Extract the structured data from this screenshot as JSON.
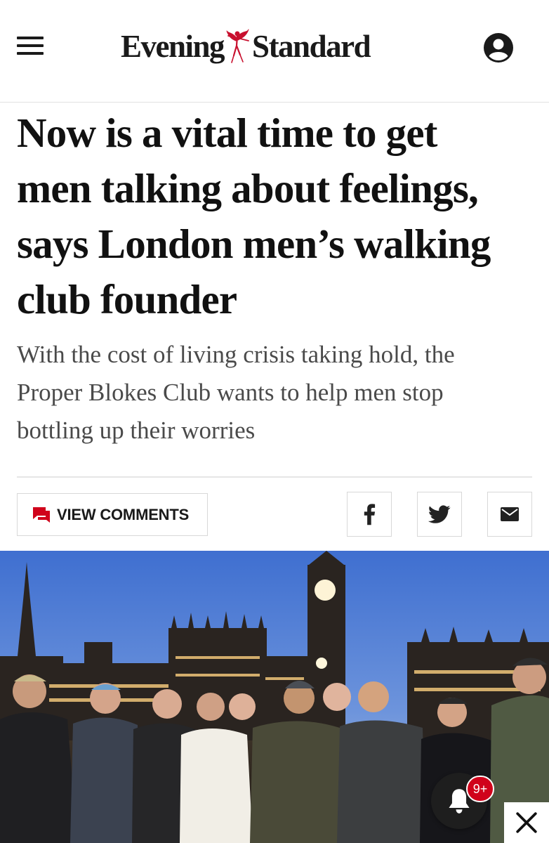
{
  "header": {
    "logo_left": "Evening",
    "logo_right": "Standard",
    "menu_icon": "hamburger-menu-icon",
    "account_icon": "user-account-icon"
  },
  "article": {
    "headline_lines": [
      "Now is a vital time to get",
      "men talking about feelings,",
      "says London men’s walking",
      "club founder"
    ],
    "standfirst_lines": [
      "With the cost of living crisis taking hold, the",
      "Proper Blokes Club wants to help men stop",
      "bottling up their worries"
    ]
  },
  "actions": {
    "comments_label": "VIEW COMMENTS",
    "comments_icon": "speech-bubble-icon",
    "share_icons": [
      "facebook-icon",
      "twitter-icon",
      "email-icon"
    ]
  },
  "notifications": {
    "badge": "9+",
    "icon": "bell-icon"
  },
  "colors": {
    "brand_red": "#d0021b",
    "text": "#1a1a1a",
    "standfirst": "#4a4a4a"
  }
}
